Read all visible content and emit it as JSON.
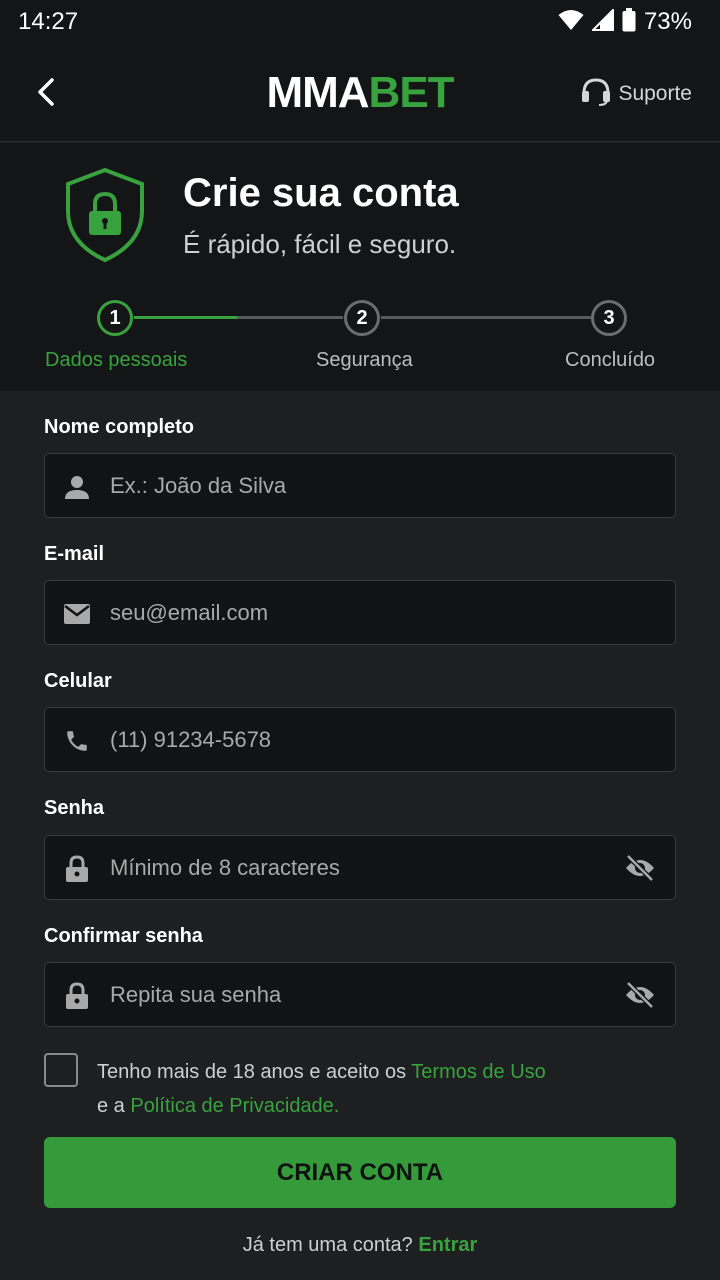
{
  "status_bar": {
    "time": "14:27",
    "battery": "73%"
  },
  "header": {
    "logo_part1": "MMA",
    "logo_part2": "BET",
    "support_label": "Suporte"
  },
  "hero": {
    "title": "Crie sua conta",
    "subtitle": "É rápido, fácil e seguro."
  },
  "stepper": {
    "steps": [
      {
        "number": "1",
        "label": "Dados pessoais"
      },
      {
        "number": "2",
        "label": "Segurança"
      },
      {
        "number": "3",
        "label": "Concluído"
      }
    ],
    "current_step": 1
  },
  "form": {
    "name": {
      "label": "Nome completo",
      "placeholder": "Ex.: João da Silva",
      "value": ""
    },
    "email": {
      "label": "E-mail",
      "placeholder": "seu@email.com",
      "value": ""
    },
    "phone": {
      "label": "Celular",
      "placeholder": "(11) 91234-5678",
      "value": ""
    },
    "password": {
      "label": "Senha",
      "placeholder": "Mínimo de 8 caracteres",
      "value": ""
    },
    "confirm": {
      "label": "Confirmar senha",
      "placeholder": "Repita sua senha",
      "value": ""
    }
  },
  "terms": {
    "checked": false,
    "text1": "Tenho mais de 18 anos e aceito os ",
    "terms_link": "Termos de Uso",
    "text2": "e a ",
    "privacy_link": "Política de Privacidade."
  },
  "cta_label": "CRIAR CONTA",
  "login": {
    "prompt": "Já tem uma conta? ",
    "link": "Entrar"
  },
  "colors": {
    "accent": "#38a33e",
    "background": "#1e1f21",
    "header_bg": "#141517",
    "input_bg": "#121314"
  },
  "icons": [
    "wifi-icon",
    "signal-icon",
    "battery-icon",
    "back-arrow-icon",
    "headset-icon",
    "shield-lock-icon",
    "person-icon",
    "mail-icon",
    "phone-icon",
    "lock-icon",
    "eye-off-icon"
  ]
}
